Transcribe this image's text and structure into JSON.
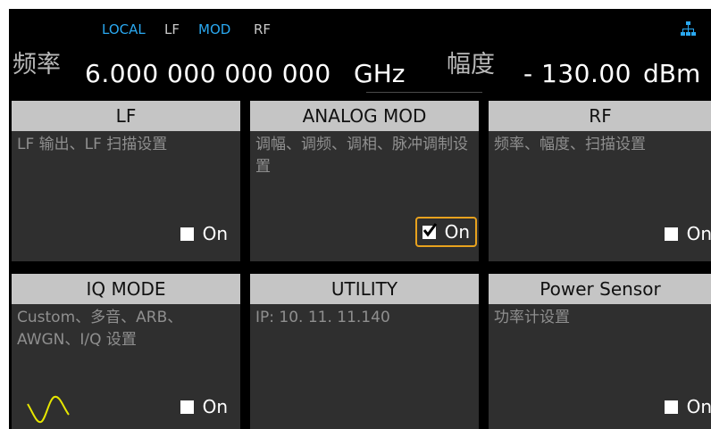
{
  "status": {
    "local": "LOCAL",
    "lf": "LF",
    "mod": "MOD",
    "rf": "RF",
    "active_color": "#2aa8f0",
    "network_icon": "network-icon"
  },
  "frequency": {
    "label": "频率",
    "value": "6.000 000 000 000",
    "unit": "GHz"
  },
  "amplitude": {
    "label": "幅度",
    "value": "- 130.00",
    "unit": "dBm"
  },
  "tiles": [
    {
      "title": "LF",
      "desc": "LF 输出、LF 扫描设置",
      "state": "On",
      "checked": false
    },
    {
      "title": "ANALOG MOD",
      "desc": "调幅、调频、调相、脉冲调制设置",
      "state": "On",
      "checked": true
    },
    {
      "title": "RF",
      "desc": "频率、幅度、扫描设置",
      "state": "On",
      "checked": false
    },
    {
      "title": "IQ MODE",
      "desc": "Custom、多音、ARB、AWGN、I/Q 设置",
      "state": "On",
      "checked": false,
      "icon": "sine-wave-icon"
    },
    {
      "title": "UTILITY",
      "desc": "IP:  10. 11. 11.140"
    },
    {
      "title": "Power Sensor",
      "desc": "功率计设置",
      "state": "On",
      "checked": false
    }
  ],
  "colors": {
    "highlight": "#e8a21e",
    "tile_bg": "#2f2f2f",
    "title_bg": "#c5c5c5",
    "wave": "#e6e600"
  }
}
